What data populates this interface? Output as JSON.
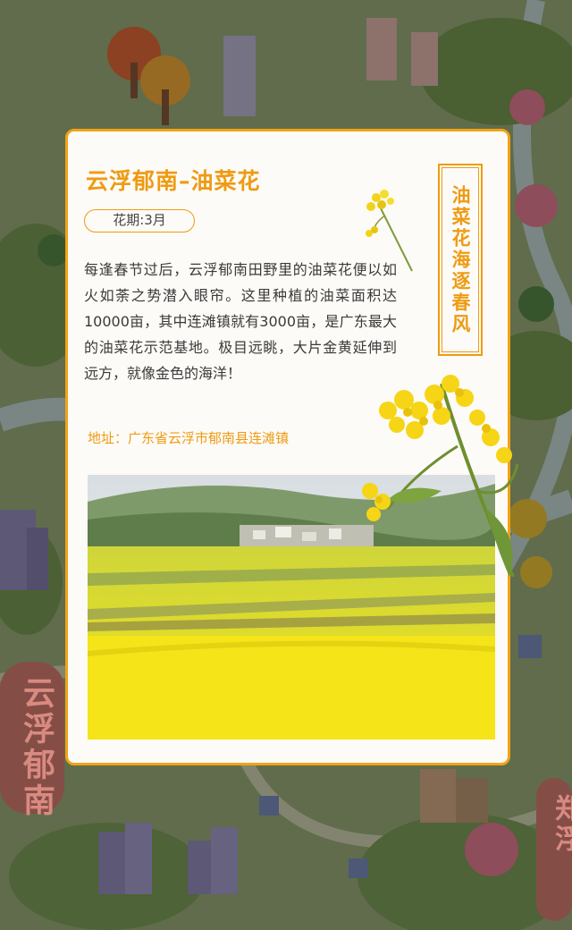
{
  "card": {
    "title": "云浮郁南–油菜花",
    "season": "花期:3月",
    "description": "每逢春节过后，云浮郁南田野里的油菜花便以如火如荼之势潜入眼帘。这里种植的油菜面积达10000亩，其中连滩镇就有3000亩，是广东最大的油菜花示范基地。极目远眺，大片金黄延伸到远方，就像金色的海洋！",
    "address": "地址：广东省云浮市郁南县连滩镇",
    "vertical_title": "油菜花海逐春风",
    "photo_alt": "rapeseed-field-photo"
  },
  "map": {
    "left_label": "云浮郁南",
    "right_label": "郑浮"
  },
  "colors": {
    "accent": "#ee9b13",
    "card_bg": "#fdfbf7",
    "map_label": "#d98a80"
  }
}
